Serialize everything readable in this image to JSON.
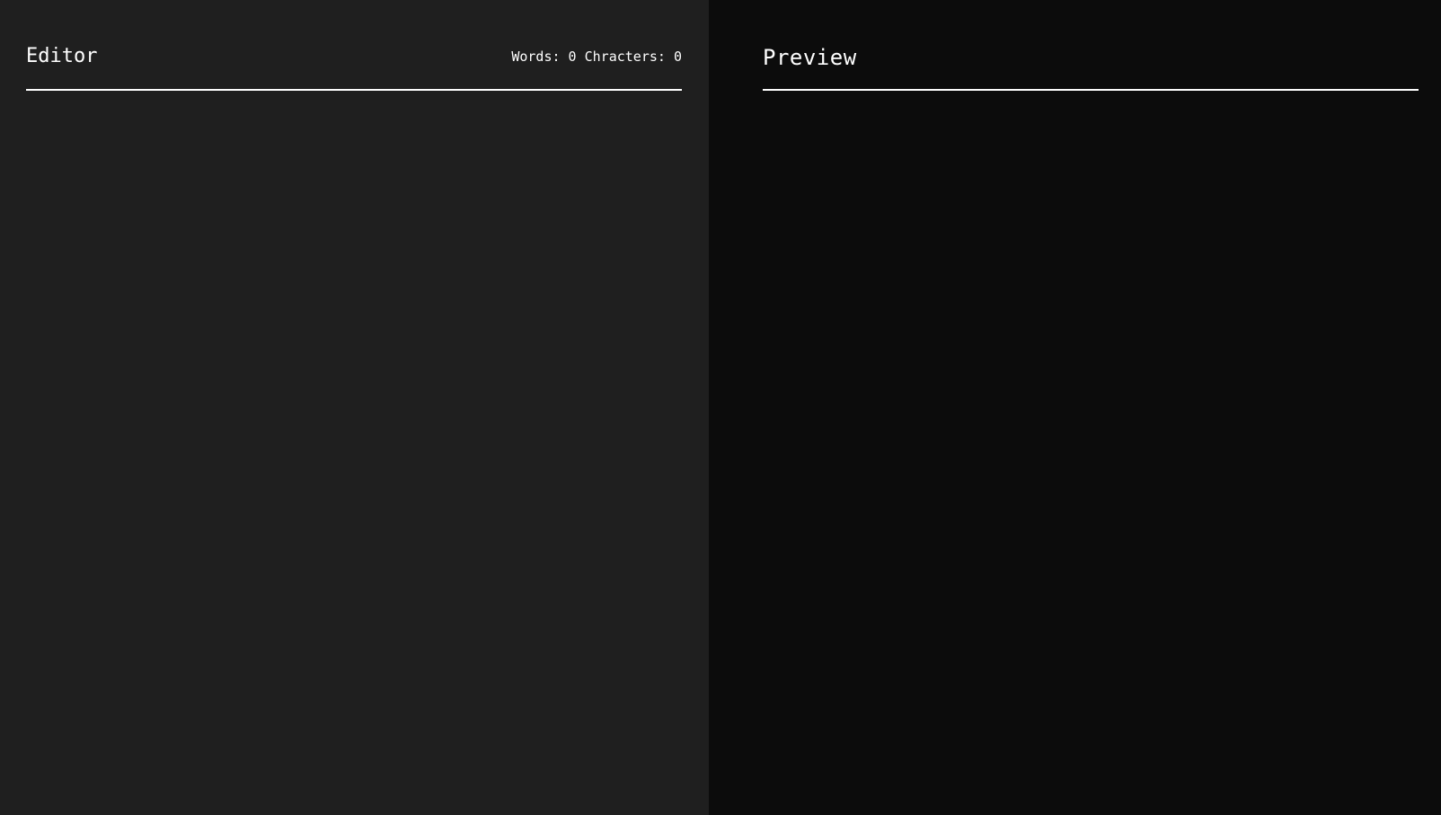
{
  "editor": {
    "title": "Editor",
    "stats_text": "Words: 0 Chracters: 0",
    "content": ""
  },
  "preview": {
    "title": "Preview",
    "content": ""
  },
  "colors": {
    "editor_bg": "#1f1f1f",
    "preview_bg": "#0c0c0c",
    "text": "#ffffff",
    "divider": "#ffffff"
  }
}
